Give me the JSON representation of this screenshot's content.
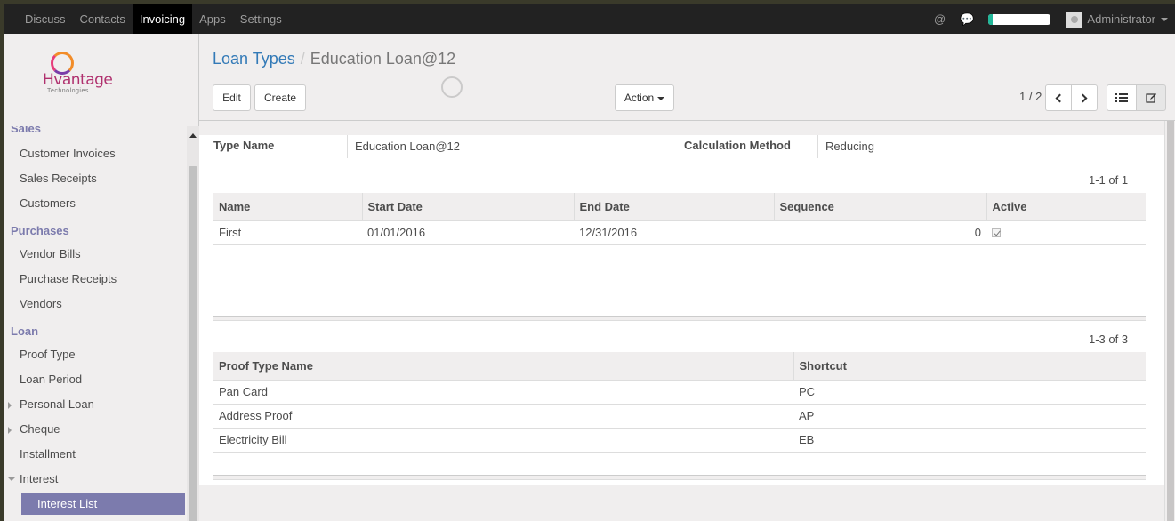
{
  "topbar": {
    "menu": [
      "Discuss",
      "Contacts",
      "Invoicing",
      "Apps",
      "Settings"
    ],
    "active_index": 2,
    "at_icon": "@",
    "chat_icon": "💬",
    "progress_fraction": 0.06,
    "user_name": "Administrator"
  },
  "logo": {
    "word": "Hvantage",
    "sub": "Technologies"
  },
  "sidebar": {
    "partial_section": "Sales",
    "sales_items": [
      "Customer Invoices",
      "Sales Receipts",
      "Customers"
    ],
    "purchases_title": "Purchases",
    "purchases_items": [
      "Vendor Bills",
      "Purchase Receipts",
      "Vendors"
    ],
    "loan_title": "Loan",
    "loan_items": [
      {
        "label": "Proof Type",
        "toggle": ""
      },
      {
        "label": "Loan Period",
        "toggle": ""
      },
      {
        "label": "Personal Loan",
        "toggle": "right"
      },
      {
        "label": "Cheque",
        "toggle": "right"
      },
      {
        "label": "Installment",
        "toggle": ""
      },
      {
        "label": "Interest",
        "toggle": "down"
      }
    ],
    "active_item": "Interest List"
  },
  "breadcrumb": {
    "parent": "Loan Types",
    "sep": "/",
    "current": "Education Loan@12"
  },
  "toolbar": {
    "edit": "Edit",
    "create": "Create",
    "action": "Action",
    "pager": "1 / 2"
  },
  "form": {
    "type_name_label": "Type Name",
    "type_name_value": "Education Loan@12",
    "calc_label": "Calculation Method",
    "calc_value": "Reducing"
  },
  "periods": {
    "count": "1-1 of 1",
    "headers": [
      "Name",
      "Start Date",
      "End Date",
      "Sequence",
      "Active"
    ],
    "rows": [
      {
        "name": "First",
        "start": "01/01/2016",
        "end": "12/31/2016",
        "sequence": "0",
        "active": true
      }
    ]
  },
  "proofs": {
    "count": "1-3 of 3",
    "headers": [
      "Proof Type Name",
      "Shortcut"
    ],
    "rows": [
      {
        "name": "Pan Card",
        "shortcut": "PC"
      },
      {
        "name": "Address Proof",
        "shortcut": "AP"
      },
      {
        "name": "Electricity Bill",
        "shortcut": "EB"
      }
    ]
  }
}
